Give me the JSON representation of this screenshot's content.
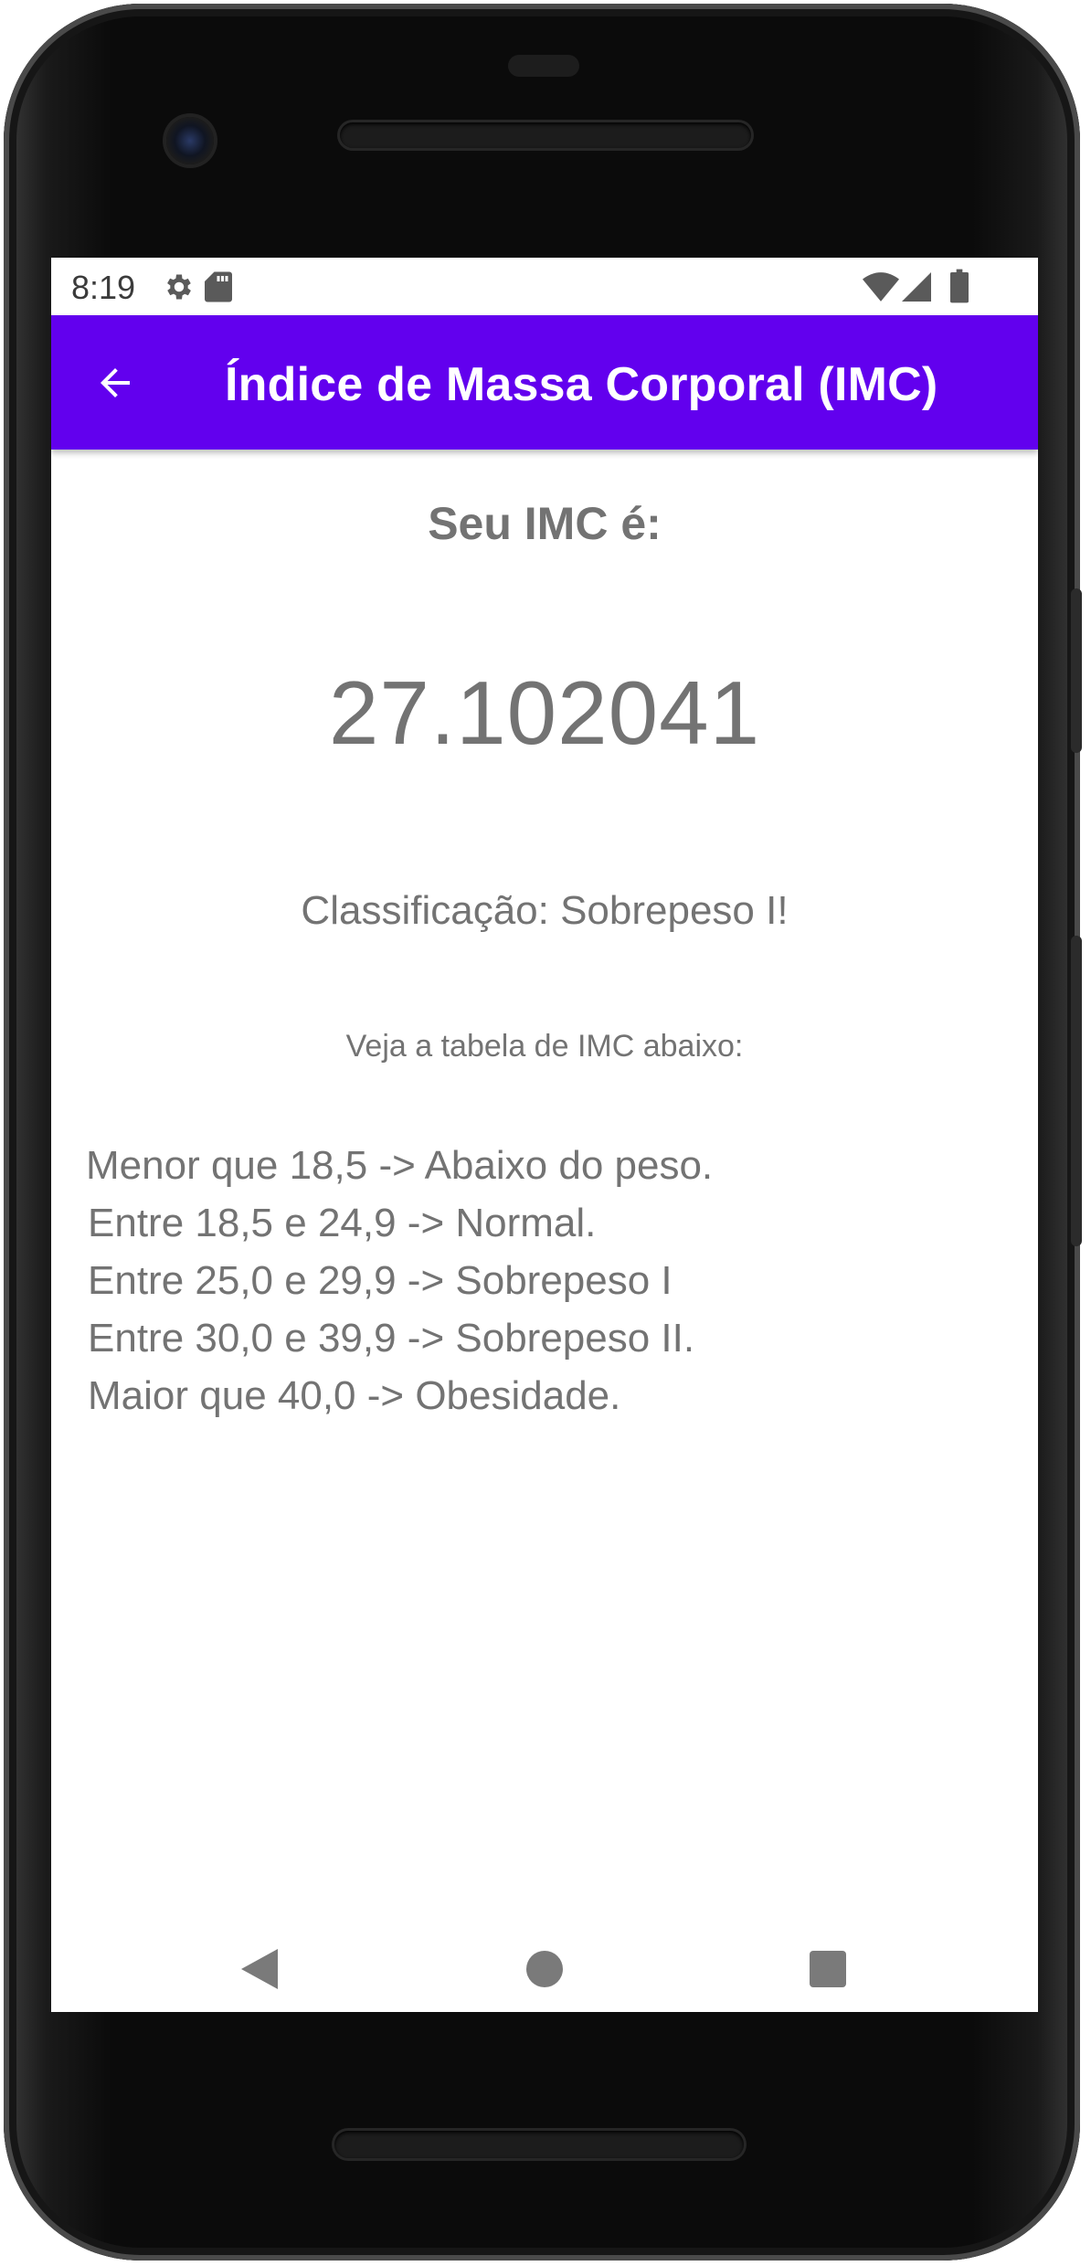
{
  "status_bar": {
    "time": "8:19",
    "icons_left": [
      "settings-icon",
      "sd-card-icon"
    ],
    "icons_right": [
      "wifi-icon",
      "cell-signal-icon",
      "battery-icon"
    ]
  },
  "app_bar": {
    "title": "Índice de Massa Corporal (IMC)",
    "back_icon": "arrow-back-icon",
    "background": "#6200ee"
  },
  "result": {
    "heading": "Seu IMC é:",
    "value": "27.102041",
    "classification": "Classificação: Sobrepeso I!",
    "table_hint": "Veja a tabela de IMC abaixo:"
  },
  "imc_table": [
    "Menor que 18,5 -> Abaixo do peso.",
    "Entre 18,5 e 24,9 -> Normal.",
    "Entre 25,0 e 29,9 -> Sobrepeso I",
    "Entre 30,0 e 39,9 -> Sobrepeso II.",
    "Maior que 40,0 -> Obesidade."
  ],
  "nav_bar": {
    "buttons": [
      "back-triangle-icon",
      "home-circle-icon",
      "recents-square-icon"
    ]
  },
  "colors": {
    "accent": "#6200ee",
    "text_gray": "#737373"
  }
}
